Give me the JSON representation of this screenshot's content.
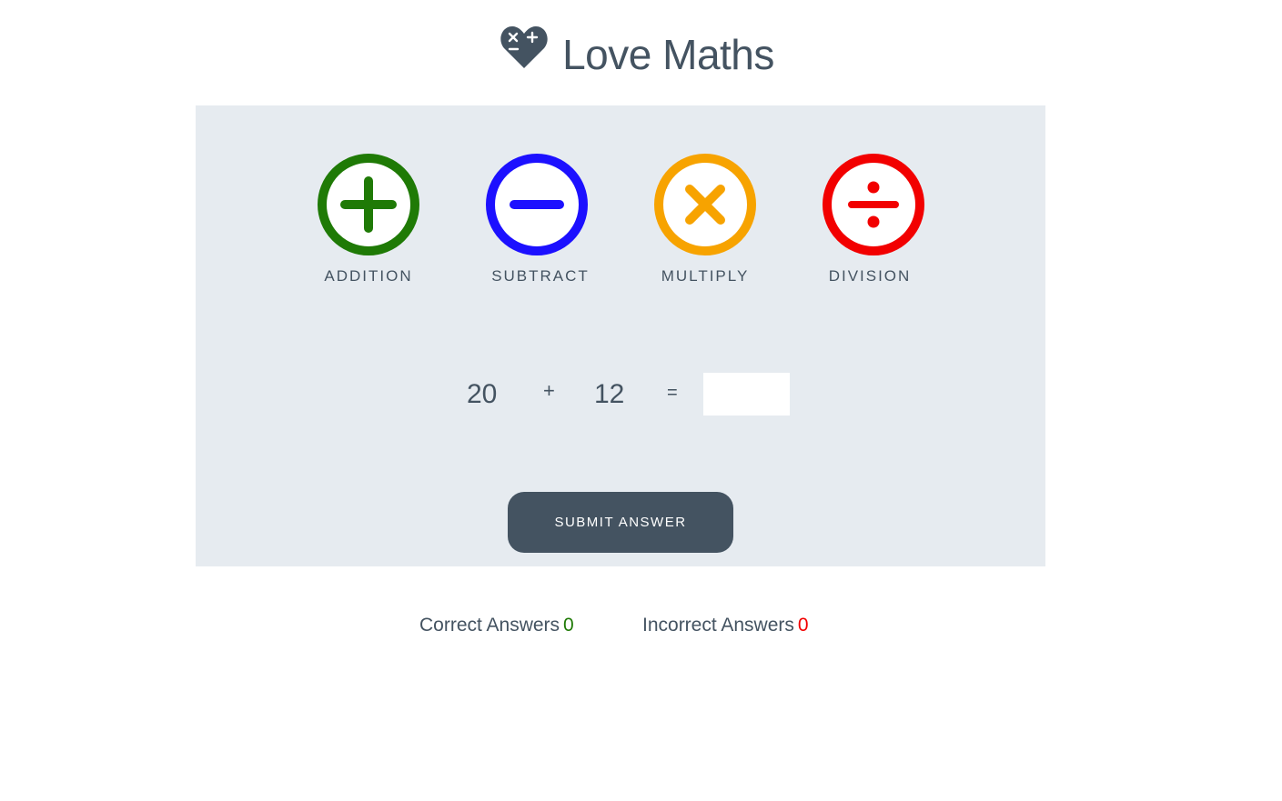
{
  "header": {
    "title": "Love Maths",
    "logo_icon": "heart-operators-icon"
  },
  "operations": [
    {
      "label": "ADDITION",
      "icon": "plus-circle-icon",
      "color": "#1f7a06"
    },
    {
      "label": "SUBTRACT",
      "icon": "minus-circle-icon",
      "color": "#1c10ff"
    },
    {
      "label": "MULTIPLY",
      "icon": "times-circle-icon",
      "color": "#f7a300"
    },
    {
      "label": "DIVISION",
      "icon": "divide-circle-icon",
      "color": "#f20000"
    }
  ],
  "question": {
    "operand1": "20",
    "operator": "+",
    "operand2": "12",
    "equals": "=",
    "answer_value": ""
  },
  "submit": {
    "label": "SUBMIT ANSWER"
  },
  "scores": {
    "correct_label": "Correct Answers",
    "correct_value": "0",
    "correct_color": "#1f7a06",
    "incorrect_label": "Incorrect Answers",
    "incorrect_value": "0",
    "incorrect_color": "#f20000"
  },
  "colors": {
    "text": "#445361",
    "panel": "#e6ebf0",
    "button": "#445361"
  }
}
